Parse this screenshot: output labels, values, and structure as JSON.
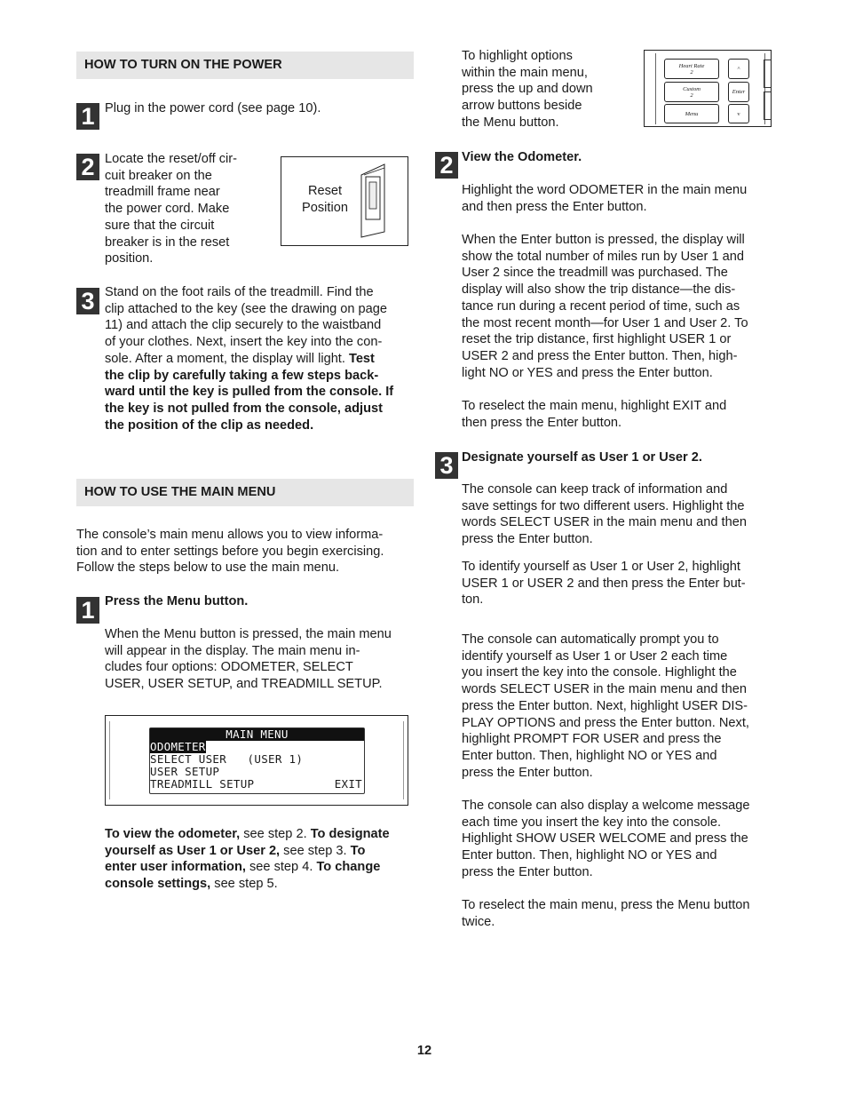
{
  "left": {
    "power_header": "HOW TO TURN ON THE POWER",
    "power_steps": [
      {
        "num": "1",
        "text": "Plug in the power cord (see page 10)."
      },
      {
        "num": "2",
        "text": "Locate the reset/off cir-\ncuit breaker on the\ntreadmill frame near\nthe power cord. Make\nsure that the circuit\nbreaker is in the reset\nposition."
      },
      {
        "num": "3",
        "text": "Stand on the foot rails of the treadmill. Find the\nclip attached to the key (see the drawing on page\n11) and attach the clip securely to the waistband\nof your clothes. Next, insert the key into the con-\nsole. After a moment, the display will light. ",
        "bold": "Test\nthe clip by carefully taking a few steps back-\nward until the key is pulled from the console. If\nthe key is not pulled from the console, adjust\nthe position of the clip as needed."
      }
    ],
    "reset_figure": {
      "label": "Reset\nPosition"
    },
    "menu_header": "HOW TO USE THE MAIN MENU",
    "menu_intro": "The console’s main menu allows you to view informa-\ntion and to enter settings before you begin exercising.\nFollow the steps below to use the main menu.",
    "menu_step1": {
      "num": "1",
      "heading": "Press the Menu button.",
      "text": "When the Menu button is pressed, the main menu\nwill appear in the display. The main menu in-\ncludes four options: ODOMETER, SELECT\nUSER, USER SETUP, and TREADMILL SETUP."
    },
    "display": {
      "title": "MAIN MENU",
      "rows": [
        "ODOMETER",
        "SELECT USER   (USER 1)",
        "USER SETUP",
        "TREADMILL SETUP"
      ],
      "exit": "EXIT",
      "highlighted": "ODOMETER"
    },
    "summary": [
      {
        "b": "To view the odometer,"
      },
      {
        "t": " see step 2. "
      },
      {
        "b": "To designate\nyourself as User 1 or User 2,"
      },
      {
        "t": " see step 3. "
      },
      {
        "b": "To\nenter user information,"
      },
      {
        "t": " see step 4. "
      },
      {
        "b": "To change\nconsole settings,"
      },
      {
        "t": " see step 5."
      }
    ]
  },
  "right": {
    "intro": "To highlight options\nwithin the main menu,\npress the up and down\narrow buttons beside\nthe Menu button.",
    "buttons": {
      "heart_rate": "Heart Rate\n2",
      "custom": "Custom\n2",
      "menu": "Menu",
      "up": "^",
      "enter": "Enter",
      "down": "v"
    },
    "step2": {
      "num": "2",
      "heading": "View the Odometer.",
      "paras": [
        "Highlight the word ODOMETER in the main menu\nand then press the Enter button.",
        "When the Enter button is pressed, the display will\nshow the total number of miles run by User 1 and\nUser 2 since the treadmill was purchased. The\ndisplay will also show the trip distance—the dis-\ntance run during a recent period of  time, such as\nthe most recent month—for User 1 and User 2. To\nreset the trip distance, first highlight USER 1 or\nUSER 2 and press the Enter button. Then, high-\nlight NO or YES and press the Enter button.",
        "To reselect the main menu, highlight EXIT and\nthen press the Enter button."
      ]
    },
    "step3": {
      "num": "3",
      "heading": "Designate yourself as User 1 or User 2.",
      "paras": [
        "The console can keep track of information and\nsave settings for two different users. Highlight the\nwords SELECT USER in the main menu and then\npress the Enter button.",
        "To identify yourself as User 1 or User 2, highlight\nUSER 1 or USER 2 and then press the Enter but-\nton.",
        "The console can automatically prompt you to\nidentify yourself as User 1 or User 2 each time\nyou insert the key into the console. Highlight the\nwords SELECT USER in the main menu and then\npress the Enter button. Next, highlight USER DIS-\nPLAY OPTIONS and press the Enter button. Next,\nhighlight PROMPT FOR USER and press the\nEnter button. Then, highlight NO or YES and\npress the Enter button.",
        "The console can also display a welcome message\neach time you insert the key into the console.\nHighlight SHOW USER WELCOME and press the\nEnter button. Then, highlight NO or YES and\npress the Enter button.",
        "To reselect the main menu, press the Menu button\ntwice."
      ]
    }
  },
  "page_number": "12"
}
